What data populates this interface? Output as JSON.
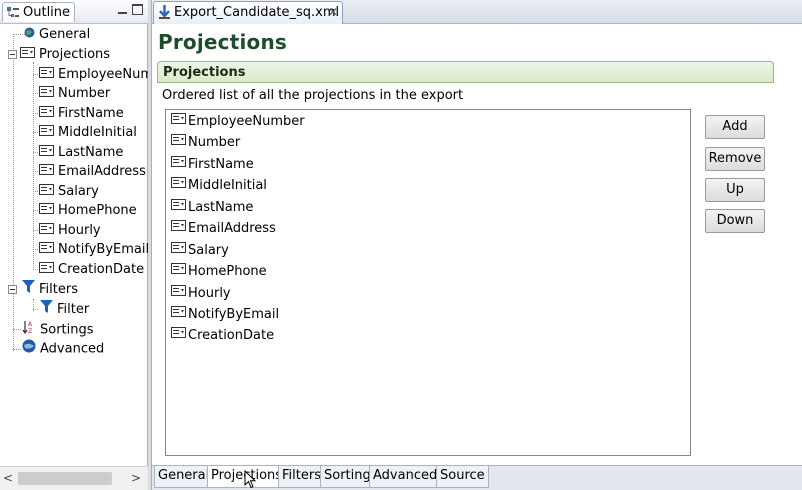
{
  "outline": {
    "title": "Outline",
    "tree": {
      "general": "General",
      "projections": "Projections",
      "projection_items": [
        "EmployeeNum",
        "Number",
        "FirstName",
        "MiddleInitial",
        "LastName",
        "EmailAddress",
        "Salary",
        "HomePhone",
        "Hourly",
        "NotifyByEmail",
        "CreationDate"
      ],
      "filters": "Filters",
      "filter_child": "Filter",
      "sortings": "Sortings",
      "advanced": "Advanced"
    },
    "hscroll": {
      "left": "<",
      "right": ">"
    }
  },
  "editor": {
    "tab_title": "Export_Candidate_sq.xml",
    "tab_close": "✕",
    "page_title": "Projections",
    "section_title": "Projections",
    "section_description": "Ordered list of all the projections in the export",
    "projections": [
      "EmployeeNumber",
      "Number",
      "FirstName",
      "MiddleInitial",
      "LastName",
      "EmailAddress",
      "Salary",
      "HomePhone",
      "Hourly",
      "NotifyByEmail",
      "CreationDate"
    ],
    "buttons": {
      "add": "Add",
      "remove": "Remove",
      "up": "Up",
      "down": "Down"
    },
    "bottom_tabs": [
      "General",
      "Projections",
      "Filters",
      "Sorting",
      "Advanced",
      "Source"
    ],
    "active_bottom_tab": "Projections"
  },
  "icons": {
    "outline_tab": "outline-icon",
    "general": "globe-icon",
    "projection": "column-icon",
    "filters": "funnel-icon",
    "sortings": "sort-icon",
    "advanced": "advanced-globe-icon",
    "editor_tab": "xml-file-icon"
  },
  "colors": {
    "page_title": "#1e4d2b",
    "section_header_bg": "#dbe9cc",
    "funnel": "#1f5fbf"
  }
}
